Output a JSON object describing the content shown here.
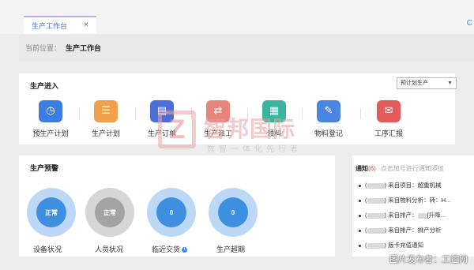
{
  "tabs": [
    {
      "label": "生产工作台",
      "close": "×"
    }
  ],
  "corner_glyph": "C",
  "location": {
    "label": "当前位置：",
    "value": "生产工作台"
  },
  "production_entry": {
    "title": "生产进入",
    "select_value": "预计划生产",
    "items": [
      {
        "label": "预生产计划",
        "icon": "document-clock-icon",
        "color": "#3e7de0",
        "glyph": "◷"
      },
      {
        "label": "生产计划",
        "icon": "calendar-list-icon",
        "color": "#f0a04a",
        "glyph": "☰"
      },
      {
        "label": "生产订单",
        "icon": "clipboard-icon",
        "color": "#4a6fd8",
        "glyph": "▤"
      },
      {
        "label": "生产派工",
        "icon": "dispatch-icon",
        "color": "#e7847c",
        "glyph": "⇄"
      },
      {
        "label": "领料",
        "icon": "material-pick-icon",
        "color": "#3ab59d",
        "glyph": "▦"
      },
      {
        "label": "物料登记",
        "icon": "edit-register-icon",
        "color": "#4a85e0",
        "glyph": "✎"
      },
      {
        "label": "工序汇报",
        "icon": "envelope-icon",
        "color": "#e45a5a",
        "glyph": "✉"
      }
    ]
  },
  "production_warning": {
    "title": "生产预警",
    "gauges": [
      {
        "label": "设备状况",
        "value": "正常",
        "style": "blue"
      },
      {
        "label": "人员状况",
        "value": "正常",
        "style": "gray"
      },
      {
        "label": "临近交货",
        "value": "0",
        "style": "blue",
        "info": "i"
      },
      {
        "label": "生产超期",
        "value": "0",
        "style": "blue"
      }
    ]
  },
  "notices": {
    "title": "通知",
    "count": "(6)",
    "hint": "点击加号进行通知添加",
    "items": [
      {
        "prefix": "(",
        "suffix": ") 来自项目：超重机械"
      },
      {
        "prefix": "(",
        "suffix": ") 来自物料分析：转：H..."
      },
      {
        "prefix": "(",
        "suffix": ") 来自排产：",
        "tail": "[升降..."
      },
      {
        "prefix": "(",
        "suffix": ") 来自排产：排产分析"
      },
      {
        "prefix": "(",
        "suffix": ") 版卡充值通知"
      }
    ]
  },
  "watermark": {
    "mark": "Z",
    "big": "智邦国际",
    "small": "数智一体化先行者"
  },
  "credit": "图片发布者：工控网"
}
